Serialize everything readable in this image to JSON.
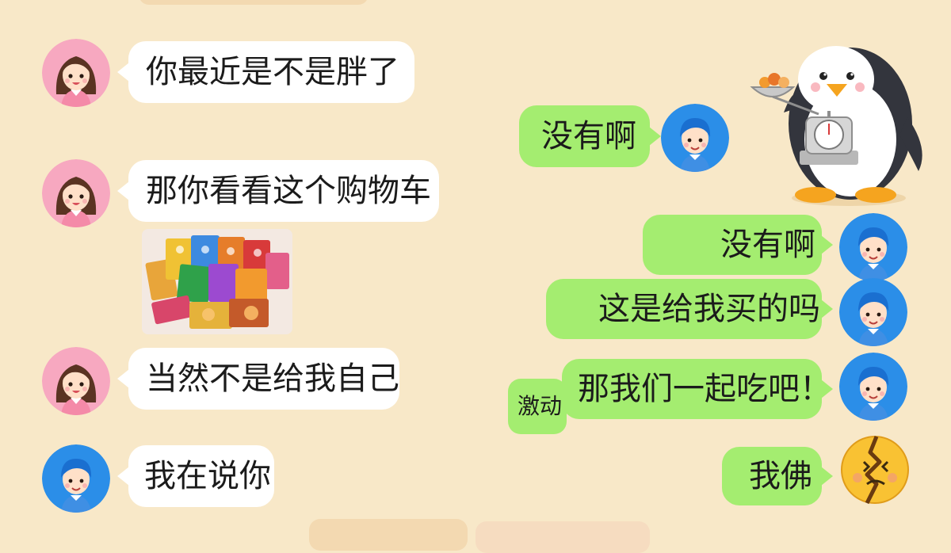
{
  "conversation": {
    "messages": [
      {
        "sender": "friend",
        "text": "你最近是不是胖了"
      },
      {
        "sender": "me",
        "text": "没有啊"
      },
      {
        "sender": "friend",
        "text": "那你看看这个购物车"
      },
      {
        "sender": "friend",
        "type": "image",
        "image": "snack-bags-shopping-cart"
      },
      {
        "sender": "me",
        "text": "没有啊"
      },
      {
        "sender": "me",
        "text": "这是给我买的吗"
      },
      {
        "sender": "friend",
        "text": "当然不是给我自己"
      },
      {
        "sender": "me",
        "text": "那我们一起吃吧！",
        "note": "激动"
      },
      {
        "sender": "me-avatar-left",
        "text": "我在说你"
      },
      {
        "sender": "me",
        "text": "我佛",
        "reaction": "broken-face-emoji"
      }
    ]
  },
  "sticker": {
    "icon": "penguin-weighing-scale-sticker"
  },
  "colors": {
    "background": "#f8e8c8",
    "received_bubble": "#ffffff",
    "sent_bubble": "#a4ed70",
    "text": "#1b1b1b"
  }
}
